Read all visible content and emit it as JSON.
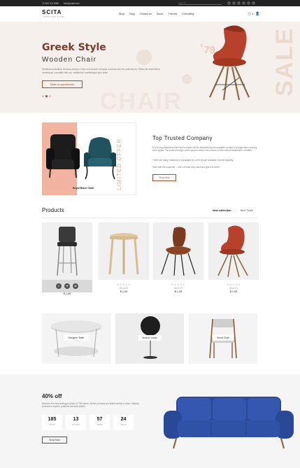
{
  "topbar": {
    "phone": "+1 000 123 8080",
    "email": "info@ymail.com",
    "search_placeholder": "Search..."
  },
  "nav": {
    "logo": "SCITA",
    "logo_sub": "FURNITURE STORE",
    "menu": [
      "Shop",
      "Blog",
      "Contact us",
      "Home",
      "Themes",
      "Consulting"
    ],
    "cart_count": "0"
  },
  "hero": {
    "title": "Greek Style",
    "subtitle": "Wooden Chair",
    "description": "Vestibulum facilisis, thoncus tempor. Duis non cursus volutpat, rhoncus nisi nec pulvinar ex. Etiam sit amet libero consequat, convallis odio ac, vestibulum scelerisque quis enim.",
    "button": "Make an appointment",
    "price_currency": "$",
    "price": "79",
    "watermark_sale": "SALE",
    "watermark_chair": "CHAIR",
    "active_slide": 1,
    "slides": 3
  },
  "trusted": {
    "offer_label": "LIMITED OFFER",
    "offer_caption": "Royal Black Chair",
    "title": "Top Trusted Company",
    "para1": "It is a long established fact that a reader will be distracted by the readable content of a page when looking at its layout. The point of using Lorem Ipsum is that it has a more-or-less normal distribution of letters.",
    "para2": "There are many variations of passages of Lorem Ipsum available, but the majority.",
    "para3": "Start with the customer – find out what they want and give it to them.",
    "button": "Shop Now"
  },
  "products": {
    "title": "Products",
    "tabs": [
      "New collection",
      "Best Seller"
    ],
    "items": [
      {
        "name": "Stool 21",
        "price": "$ 1.00",
        "rating": "★★★★★"
      },
      {
        "name": "Stool 22",
        "price": "$ 1.00",
        "rating": "★★★★★"
      },
      {
        "name": "Stool 23",
        "price": "$ 1.00",
        "rating": "★★★★★"
      },
      {
        "name": "Stool 24",
        "price": "$ 1.00",
        "rating": "★★★★★"
      }
    ]
  },
  "categories": [
    {
      "label": "Designer Table"
    },
    {
      "label": "Modern Lamp"
    },
    {
      "label": "Wood Chair"
    }
  ],
  "deal": {
    "title": "40% off",
    "description": "Discover the best selling products of 750 stores. All the products are listed weekly in store, helping customers explore products are best sellers.",
    "timer": [
      {
        "value": "185",
        "label": "DAYS"
      },
      {
        "value": "13",
        "label": "HOURS"
      },
      {
        "value": "57",
        "label": "MINS"
      },
      {
        "value": "24",
        "label": "SECS"
      }
    ],
    "button": "Shop Now"
  },
  "colors": {
    "accent": "#a0522d",
    "hero_bg": "#f5f0ec",
    "offer_bg": "#f3b3a1",
    "sofa": "#2f4fa8"
  }
}
